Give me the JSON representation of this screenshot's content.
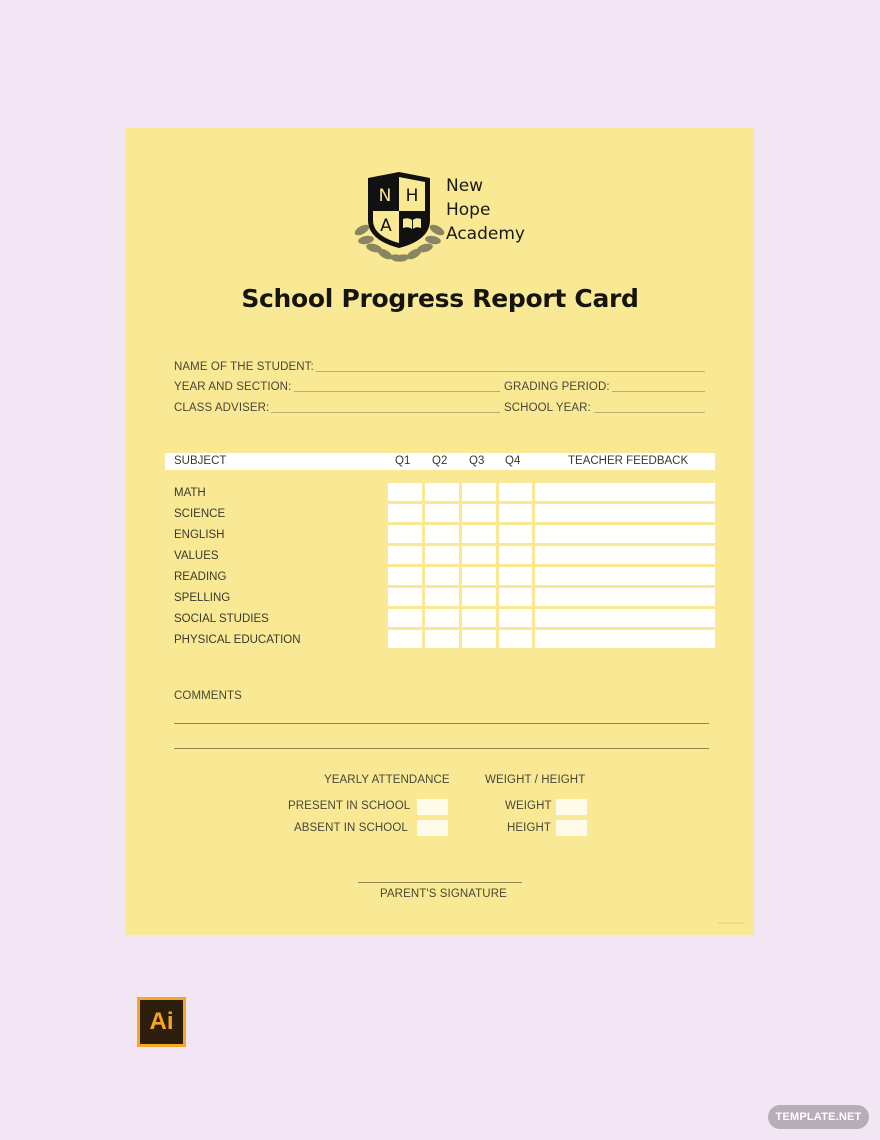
{
  "school": {
    "initials": [
      "N",
      "H",
      "A"
    ],
    "name_lines": [
      "New",
      "Hope",
      "Academy"
    ]
  },
  "title": "School Progress Report Card",
  "student_info": {
    "name_label": "NAME OF THE STUDENT:",
    "year_section_label": "YEAR AND SECTION:",
    "grading_period_label": "GRADING PERIOD:",
    "class_adviser_label": "CLASS ADVISER:",
    "school_year_label": "SCHOOL YEAR:"
  },
  "grades_table": {
    "headers": {
      "subject": "SUBJECT",
      "q1": "Q1",
      "q2": "Q2",
      "q3": "Q3",
      "q4": "Q4",
      "feedback": "TEACHER FEEDBACK"
    },
    "subjects": [
      "MATH",
      "SCIENCE",
      "ENGLISH",
      "VALUES",
      "READING",
      "SPELLING",
      "SOCIAL STUDIES",
      "PHYSICAL EDUCATION"
    ]
  },
  "comments": {
    "label": "COMMENTS"
  },
  "attendance": {
    "heading": "YEARLY ATTENDANCE",
    "present_label": "PRESENT IN SCHOOL",
    "absent_label": "ABSENT IN SCHOOL"
  },
  "measurements": {
    "heading": "WEIGHT / HEIGHT",
    "weight_label": "WEIGHT",
    "height_label": "HEIGHT"
  },
  "signature": {
    "label": "PARENT'S SIGNATURE"
  },
  "file_badge": {
    "icon": "adobe-illustrator-icon",
    "text": "Ai"
  },
  "brand": {
    "text": "TEMPLATE.NET"
  },
  "colors": {
    "page_bg": "#f3e6f4",
    "card_bg": "#f9e995",
    "ai_orange": "#f6a623",
    "ai_dark": "#2d1e0c"
  }
}
